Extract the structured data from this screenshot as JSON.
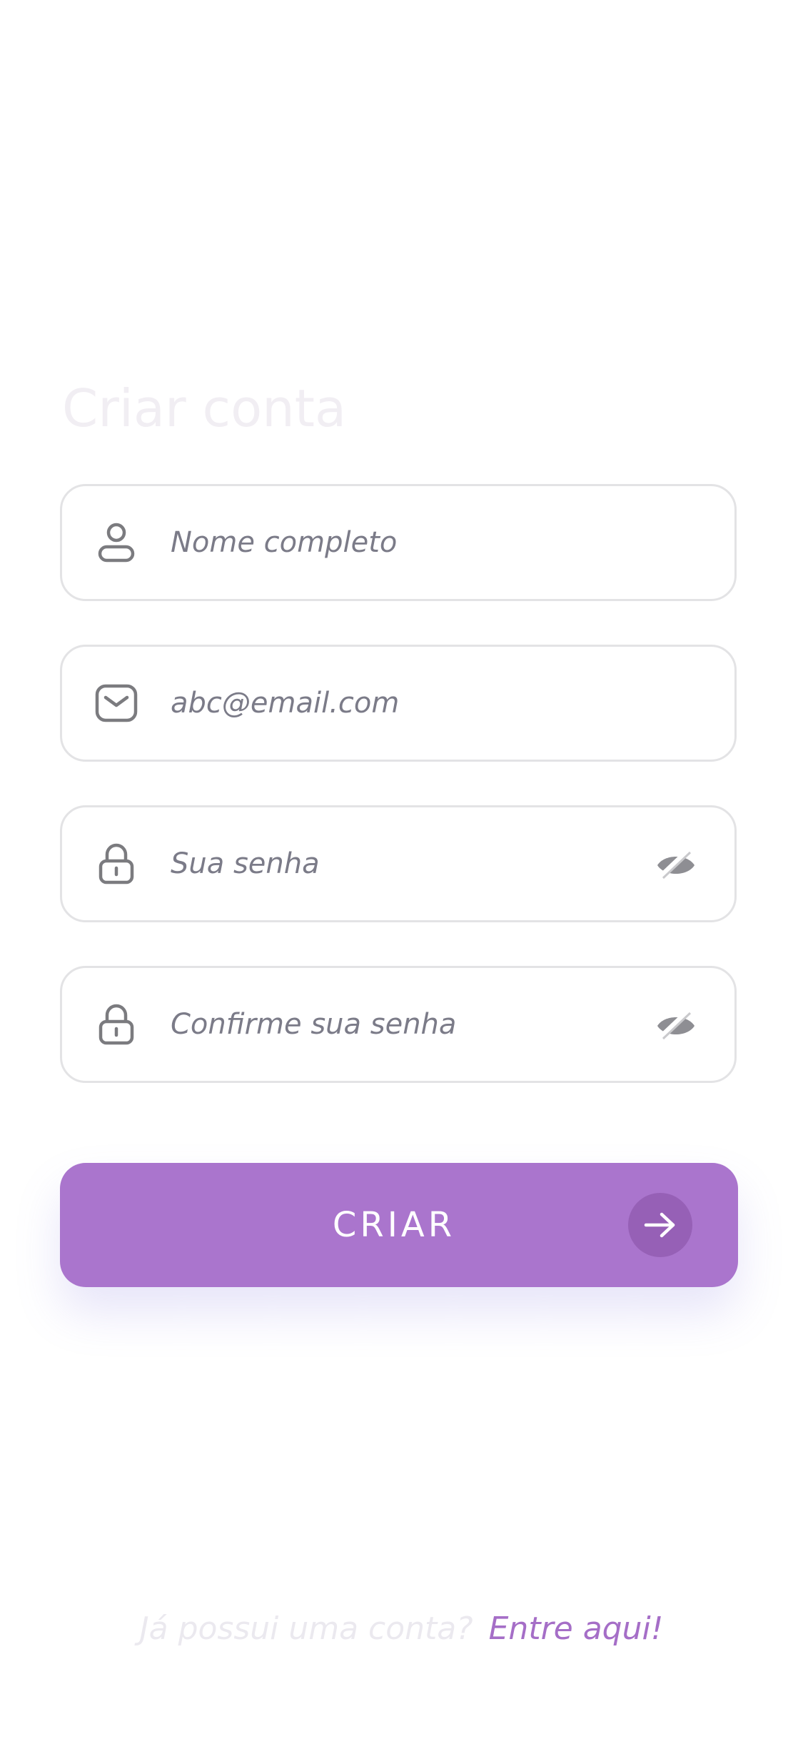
{
  "header": {
    "title": "Criar conta"
  },
  "form": {
    "fields": [
      {
        "icon": "user-icon",
        "placeholder": "Nome completo",
        "value": ""
      },
      {
        "icon": "mail-icon",
        "placeholder": "abc@email.com",
        "value": ""
      },
      {
        "icon": "lock-icon",
        "placeholder": "Sua senha",
        "value": "",
        "trailing_icon": "eye-off-icon"
      },
      {
        "icon": "lock-icon",
        "placeholder": "Confirme sua senha",
        "value": "",
        "trailing_icon": "eye-off-icon"
      }
    ],
    "submit_label": "CRIAR",
    "submit_icon": "arrow-right-icon"
  },
  "footer": {
    "question": "Já possui uma conta?",
    "link": "Entre aqui!"
  },
  "colors": {
    "accent": "#aa75cd",
    "accent_dark": "#9660b6",
    "field_border": "#e3e3e5",
    "placeholder": "#7b7b88",
    "title": "#f1eef3",
    "link": "#a56ec7"
  }
}
